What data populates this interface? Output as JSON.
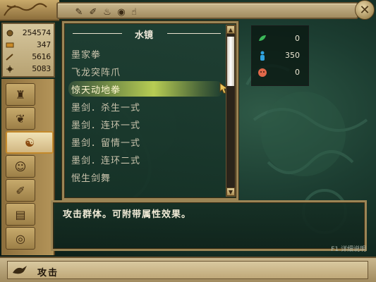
{
  "colors": {
    "frame_gold": "#9b8555",
    "panel_green": "#1f3f33",
    "highlight": "#d2e65a",
    "text_light": "#f0eadb"
  },
  "toolbar": {
    "icons": [
      "scroll-icon",
      "brush-icon",
      "bell-icon",
      "coin-icon",
      "hand-icon"
    ]
  },
  "resources": [
    {
      "icon": "coin-icon",
      "value": "254574"
    },
    {
      "icon": "bar-icon",
      "value": "347"
    },
    {
      "icon": "sword-icon",
      "value": "5616"
    },
    {
      "icon": "sun-icon",
      "value": "5083"
    }
  ],
  "tabs": [
    {
      "name": "bag-tab",
      "glyph": "♜"
    },
    {
      "name": "leaf-tab",
      "glyph": "❦"
    },
    {
      "name": "yinyang-tab",
      "glyph": "☯",
      "active": true
    },
    {
      "name": "mask-tab",
      "glyph": "☺"
    },
    {
      "name": "tools-tab",
      "glyph": "✐"
    },
    {
      "name": "book-tab",
      "glyph": "▤"
    },
    {
      "name": "seal-tab",
      "glyph": "◎"
    }
  ],
  "skill_list": {
    "title": "水镜",
    "items": [
      "墨家拳",
      "飞龙突阵爪",
      "惊天动地拳",
      "墨剑．杀生一式",
      "墨剑．连环一式",
      "墨剑．留情一式",
      "墨剑．连环二式",
      "怋生剑舞"
    ],
    "selected_index": 2
  },
  "status": [
    {
      "icon": "leaf-icon",
      "color": "#3cb85a",
      "value": "0"
    },
    {
      "icon": "figure-icon",
      "color": "#2fa3e0",
      "value": "350"
    },
    {
      "icon": "mask-icon",
      "color": "#e0684a",
      "value": "0"
    }
  ],
  "description": {
    "text": "攻击群体。可附带属性效果。",
    "hint": "F1 详细说明"
  },
  "bottom": {
    "action_label": "攻击"
  }
}
